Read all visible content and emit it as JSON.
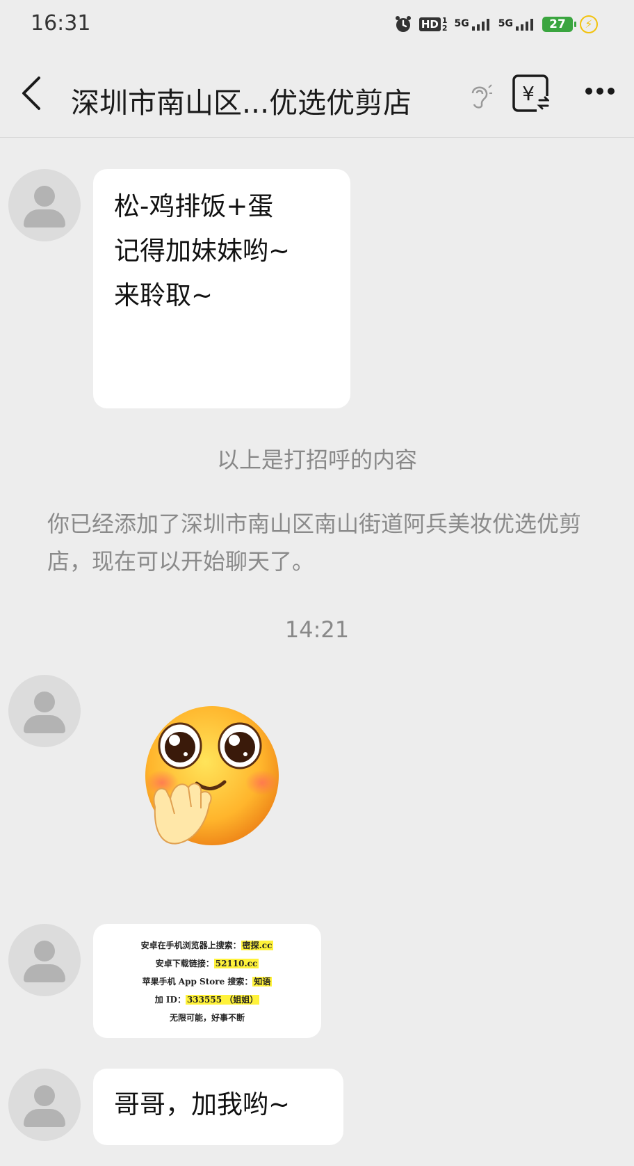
{
  "status_bar": {
    "time": "16:31",
    "hd": "HD",
    "hd_sub_top": "1",
    "hd_sub_bottom": "2",
    "network_1": "5G",
    "network_2": "5G",
    "battery": "27",
    "icons": [
      "alarm-icon",
      "signal-icon",
      "signal-icon",
      "battery-icon",
      "charging-bolt-icon"
    ]
  },
  "nav": {
    "title": "深圳市南山区...优选优剪店",
    "icons": [
      "back-icon",
      "ear-icon",
      "money-transfer-icon",
      "more-icon"
    ],
    "money_symbol": "¥"
  },
  "messages": {
    "greeting": {
      "lines": [
        "松-鸡排饭+蛋",
        "记得加妹妹哟~",
        "来聆取~"
      ]
    },
    "system_greeting_note": "以上是打招呼的内容",
    "system_added_notice": "你已经添加了深圳市南山区南山街道阿兵美妆优选优剪店，现在可以开始聊天了。",
    "timestamp": "14:21",
    "image_card": {
      "line1_prefix": "安卓在手机浏览器上搜索：",
      "line1_highlight": "密探.cc",
      "line2_prefix": "安卓下载链接：",
      "line2_highlight": "52110.cc",
      "line3_prefix": "苹果手机 App Store 搜索：",
      "line3_highlight": "知语",
      "line4_prefix": "加 ID：",
      "line4_highlight": "333555 （姐姐）",
      "line5": "无限可能，好事不断"
    },
    "last": {
      "text": "哥哥，加我哟~"
    }
  },
  "colors": {
    "background": "#ededed",
    "bubble": "#ffffff",
    "system_text": "#888888",
    "battery": "#3aa53f",
    "bolt": "#f2c20c",
    "highlight": "#fff23a"
  }
}
